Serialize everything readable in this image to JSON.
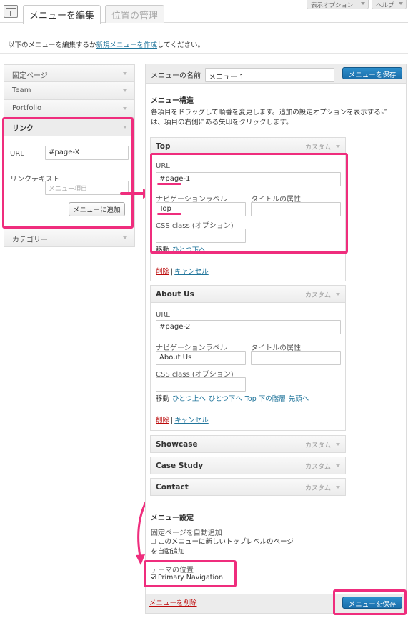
{
  "topbar": {
    "tabs": [
      {
        "label": "メニューを編集"
      },
      {
        "label": "位置の管理"
      }
    ],
    "screen_options": "表示オプション",
    "help": "ヘルプ"
  },
  "intro": {
    "before": "以下のメニューを編集するか",
    "link": "新規メニューを作成",
    "after": "してください。"
  },
  "sidebar": {
    "items": [
      {
        "label": "固定ページ"
      },
      {
        "label": "Team"
      },
      {
        "label": "Portfolio"
      }
    ],
    "link_panel": {
      "title": "リンク",
      "url_label": "URL",
      "url_value": "#page-X",
      "text_label": "リンクテキスト",
      "text_placeholder": "メニュー項目",
      "add_button": "メニューに追加"
    },
    "after_items": [
      {
        "label": "カテゴリー"
      }
    ]
  },
  "menu": {
    "name_label": "メニューの名前",
    "name_value": "メニュー 1",
    "save_button": "メニューを保存",
    "structure_title": "メニュー構造",
    "structure_desc_1": "各項目をドラッグして順番を変更します。追加の設定オプションを表示するに",
    "structure_desc_2": "は、項目の右側にある矢印をクリックします。",
    "items": [
      {
        "title": "Top",
        "type": "カスタム",
        "url_label": "URL",
        "url": "#page-1",
        "nav_label": "ナビゲーションラベル",
        "nav_value": "Top",
        "attr_label": "タイトルの属性",
        "attr_value": "",
        "css_label": "CSS class (オプション)",
        "css_value": "",
        "move_label": "移動",
        "move_links": [
          "ひとつ下へ"
        ],
        "remove": "削除",
        "divider": "|",
        "cancel": "キャンセル"
      },
      {
        "title": "About Us",
        "type": "カスタム",
        "url_label": "URL",
        "url": "#page-2",
        "nav_label": "ナビゲーションラベル",
        "nav_value": "About Us",
        "attr_label": "タイトルの属性",
        "attr_value": "",
        "css_label": "CSS class (オプション)",
        "css_value": "",
        "move_label": "移動",
        "move_links": [
          "ひとつ上へ",
          "ひとつ下へ",
          "Top 下の階層",
          "先頭へ"
        ],
        "remove": "削除",
        "divider": "|",
        "cancel": "キャンセル"
      },
      {
        "title": "Showcase",
        "type": "カスタム"
      },
      {
        "title": "Case Study",
        "type": "カスタム"
      },
      {
        "title": "Contact",
        "type": "カスタム"
      }
    ],
    "settings": {
      "title": "メニュー設定",
      "auto_add_label": "固定ページを自動追加",
      "auto_add_text_1": "このメニューに新しいトップレベルのページ",
      "auto_add_text_2": "を自動追加",
      "auto_add_checked": false,
      "theme_location_label": "テーマの位置",
      "theme_location_option": "Primary Navigation",
      "theme_location_checked": true
    },
    "delete_link": "メニューを削除"
  },
  "colors": {
    "highlight": "#ef2d7d",
    "primary_button": "#2482c2",
    "link": "#21759b",
    "delete": "#bc0b0b"
  }
}
